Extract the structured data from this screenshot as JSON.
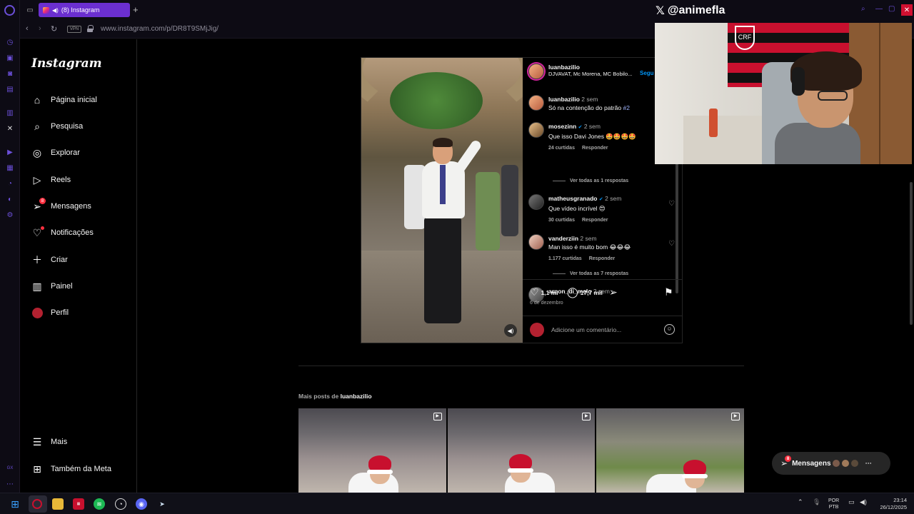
{
  "browser": {
    "tab_title": "(8) Instagram",
    "url": "www.instagram.com/p/DR8T9SMjJig/",
    "vpn_label": "VPN",
    "new_tab": "+",
    "sidebar_icons": [
      "opera-gx-logo-icon",
      "history-icon",
      "briefcase-icon",
      "instagram-icon",
      "messenger-icon",
      "twitch-icon",
      "x-icon",
      "player-icon",
      "gaming-icon",
      "chat-icon",
      "discord-icon",
      "settings-icon"
    ]
  },
  "instagram": {
    "logo": "Instagram",
    "nav": [
      {
        "label": "Página inicial",
        "icon": "home-icon"
      },
      {
        "label": "Pesquisa",
        "icon": "search-icon"
      },
      {
        "label": "Explorar",
        "icon": "compass-icon"
      },
      {
        "label": "Reels",
        "icon": "reels-icon"
      },
      {
        "label": "Mensagens",
        "icon": "messages-icon",
        "badge": "8"
      },
      {
        "label": "Notificações",
        "icon": "heart-icon"
      },
      {
        "label": "Criar",
        "icon": "plus-icon"
      },
      {
        "label": "Painel",
        "icon": "dashboard-icon"
      },
      {
        "label": "Perfil",
        "icon": "profile-avatar-icon"
      }
    ],
    "nav_bottom": [
      {
        "label": "Mais",
        "icon": "menu-icon"
      },
      {
        "label": "Também da Meta",
        "icon": "meta-icon"
      }
    ],
    "post": {
      "author": "luanbazilio",
      "audio": "DJVAVAT, Mc Morena, MC Bobilo...",
      "follow": "Segu",
      "caption_user": "luanbazilio",
      "caption_time": "2 sem",
      "caption_text": "Só na contenção do patrão",
      "caption_tag": "#2",
      "comments": [
        {
          "user": "mosezinn",
          "verified": true,
          "time": "2 sem",
          "text": "Que isso Davi Jones 🤩🤩🤩🤩",
          "likes": "24 curtidas",
          "reply": "Responder",
          "replies": "Ver todas as 1 respostas"
        },
        {
          "user": "matheusgranado",
          "verified": true,
          "time": "2 sem",
          "text": "Que vídeo incrível 😍",
          "likes": "30 curtidas",
          "reply": "Responder"
        },
        {
          "user": "vanderziin",
          "verified": false,
          "time": "2 sem",
          "text": "Man isso é muito bom 😂😂😂",
          "likes": "1.177 curtidas",
          "reply": "Responder",
          "replies": "Ver todas as 7 respostas"
        },
        {
          "user": "arnon_di_melo",
          "verified": false,
          "time": "2 sem",
          "text": ""
        }
      ],
      "likes_count": "1,1 mi",
      "comments_count": "17,7 mil",
      "date": "6 de dezembro",
      "add_comment_placeholder": "Adicione um comentário..."
    },
    "more_posts_prefix": "Mais posts de",
    "more_posts_user": "luanbazilio",
    "messages_bubble": "Mensagens",
    "messages_badge": "8"
  },
  "overlay": {
    "handle": "@animefla",
    "handle_icon": "x-logo-icon"
  },
  "taskbar": {
    "lang_line1": "POR",
    "lang_line2": "PTB",
    "time": "23:14",
    "date": "26/12/2025",
    "apps": [
      "windows-start-icon",
      "opera-gx-icon",
      "file-explorer-icon",
      "voice-app-icon",
      "spotify-icon",
      "github-icon",
      "discord-icon",
      "steam-icon"
    ]
  }
}
